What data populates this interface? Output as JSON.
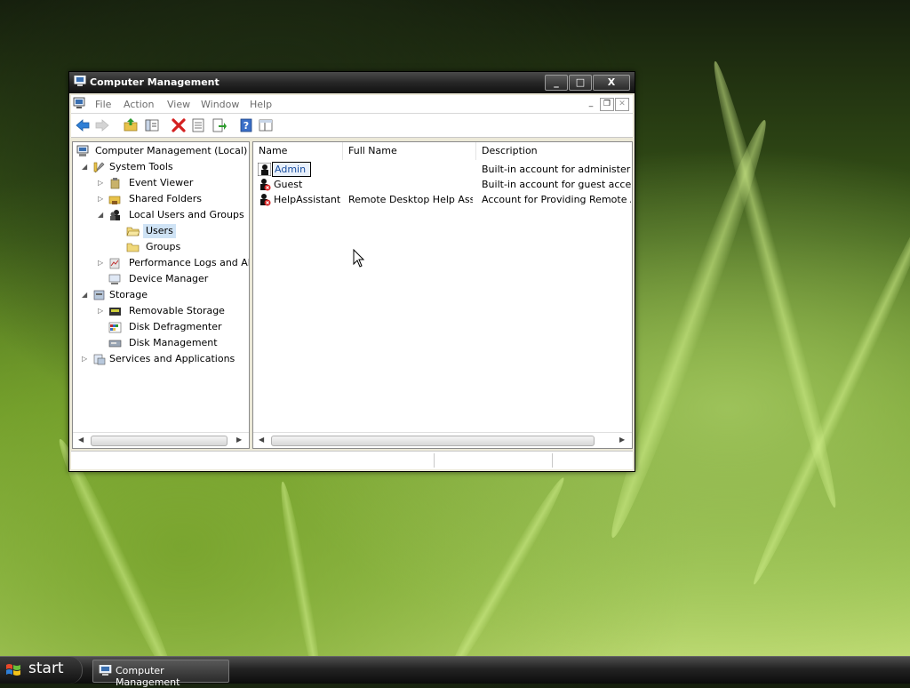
{
  "window": {
    "title": "Computer Management",
    "controls": {
      "minimize": "_",
      "maximize": "□",
      "close": "X"
    }
  },
  "menu": {
    "items": [
      "File",
      "Action",
      "View",
      "Window",
      "Help"
    ]
  },
  "toolbar": {
    "buttons": [
      "back-arrow-icon",
      "forward-arrow-icon",
      "up-folder-icon",
      "show-hide-tree-icon",
      "delete-icon",
      "properties-icon",
      "export-list-icon",
      "help-icon",
      "console-tree-icon"
    ]
  },
  "tree": {
    "root": "Computer Management (Local)",
    "system_tools": "System Tools",
    "event_viewer": "Event Viewer",
    "shared_folders": "Shared Folders",
    "local_users_groups": "Local Users and Groups",
    "users": "Users",
    "groups": "Groups",
    "perf_logs": "Performance Logs and Alert",
    "device_manager": "Device Manager",
    "storage": "Storage",
    "removable_storage": "Removable Storage",
    "disk_defrag": "Disk Defragmenter",
    "disk_management": "Disk Management",
    "services_apps": "Services and Applications"
  },
  "list": {
    "columns": [
      "Name",
      "Full Name",
      "Description"
    ],
    "rows": [
      {
        "name": "Admin",
        "full_name": "",
        "description": "Built-in account for administering t"
      },
      {
        "name": "Guest",
        "full_name": "",
        "description": "Built-in account for guest access to"
      },
      {
        "name": "HelpAssistant",
        "full_name": "Remote Desktop Help Assis...",
        "description": "Account for Providing Remote Assis"
      }
    ]
  },
  "taskbar": {
    "start_label": "start",
    "task_label": "Computer Management"
  },
  "colors": {
    "selection": "#cfe3f5",
    "titlebar": "#262626",
    "delete_icon": "#d42020",
    "nav_arrow": "#2f7fd6"
  }
}
